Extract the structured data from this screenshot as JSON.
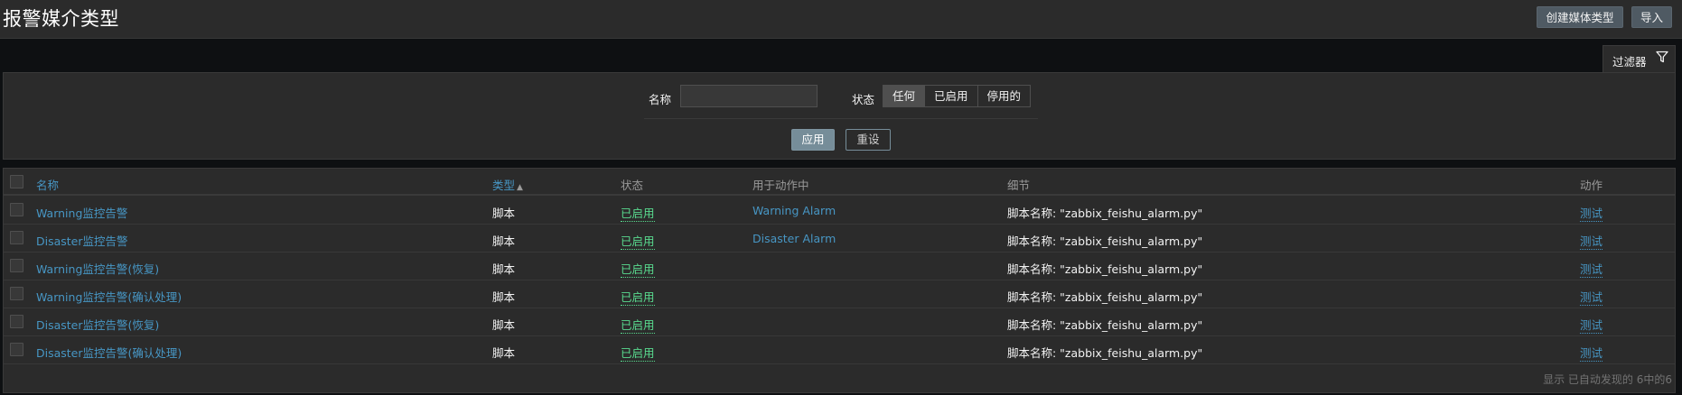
{
  "header": {
    "title": "报警媒介类型",
    "create_button": "创建媒体类型",
    "import_button": "导入"
  },
  "filter": {
    "tab_label": "过滤器",
    "tab_icon": "filter-icon",
    "name_label": "名称",
    "name_value": "",
    "status_label": "状态",
    "status_options": [
      "任何",
      "已启用",
      "停用的"
    ],
    "status_selected": "任何",
    "apply_button": "应用",
    "reset_button": "重设"
  },
  "table": {
    "columns": {
      "name": "名称",
      "type": "类型",
      "type_sort": "▲",
      "status": "状态",
      "used_in_actions": "用于动作中",
      "details": "细节",
      "action": "动作"
    },
    "rows": [
      {
        "name": "Warning监控告警",
        "type": "脚本",
        "status": "已启用",
        "used_in_actions": "Warning Alarm",
        "details": "脚本名称: \"zabbix_feishu_alarm.py\"",
        "action": "测试"
      },
      {
        "name": "Disaster监控告警",
        "type": "脚本",
        "status": "已启用",
        "used_in_actions": "Disaster Alarm",
        "details": "脚本名称: \"zabbix_feishu_alarm.py\"",
        "action": "测试"
      },
      {
        "name": "Warning监控告警(恢复)",
        "type": "脚本",
        "status": "已启用",
        "used_in_actions": "",
        "details": "脚本名称: \"zabbix_feishu_alarm.py\"",
        "action": "测试"
      },
      {
        "name": "Warning监控告警(确认处理)",
        "type": "脚本",
        "status": "已启用",
        "used_in_actions": "",
        "details": "脚本名称: \"zabbix_feishu_alarm.py\"",
        "action": "测试"
      },
      {
        "name": "Disaster监控告警(恢复)",
        "type": "脚本",
        "status": "已启用",
        "used_in_actions": "",
        "details": "脚本名称: \"zabbix_feishu_alarm.py\"",
        "action": "测试"
      },
      {
        "name": "Disaster监控告警(确认处理)",
        "type": "脚本",
        "status": "已启用",
        "used_in_actions": "",
        "details": "脚本名称: \"zabbix_feishu_alarm.py\"",
        "action": "测试"
      }
    ],
    "footer": "显示 已自动发现的 6中的6"
  },
  "colors": {
    "link": "#4796c4",
    "enabled": "#59db8f",
    "background": "#0e1012",
    "panel": "#2b2b2b"
  }
}
